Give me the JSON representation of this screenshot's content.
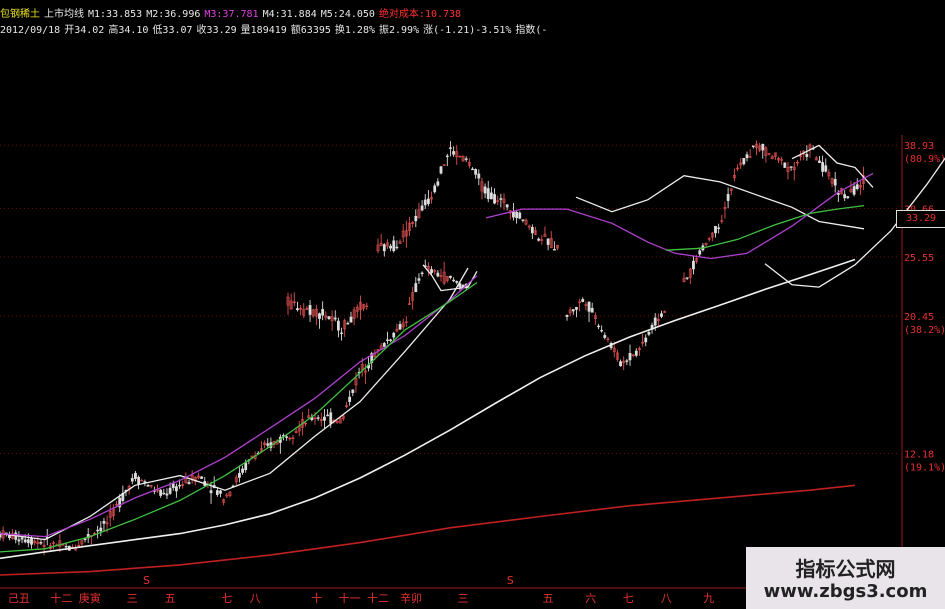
{
  "header": {
    "line1": [
      {
        "text": "包钢稀土",
        "color": "yellow"
      },
      {
        "text": "上市均线",
        "color": "white"
      },
      {
        "text": "M1:33.853",
        "color": "white"
      },
      {
        "text": "M2:36.996",
        "color": "white"
      },
      {
        "text": "M3:37.781",
        "color": "magenta"
      },
      {
        "text": "M4:31.884",
        "color": "white"
      },
      {
        "text": "M5:24.050",
        "color": "white"
      },
      {
        "text": "绝对成本:10.738",
        "color": "red"
      }
    ],
    "line2": [
      {
        "text": "2012/09/18",
        "color": "white"
      },
      {
        "text": "开34.02",
        "color": "white"
      },
      {
        "text": "高34.10",
        "color": "white"
      },
      {
        "text": "低33.07",
        "color": "white"
      },
      {
        "text": "收33.29",
        "color": "white"
      },
      {
        "text": "量189419",
        "color": "white"
      },
      {
        "text": "额63395",
        "color": "white"
      },
      {
        "text": "换1.28%",
        "color": "white"
      },
      {
        "text": "振2.99%",
        "color": "white"
      },
      {
        "text": "涨(-1.21)-3.51%",
        "color": "white"
      },
      {
        "text": "指数(-",
        "color": "white"
      }
    ]
  },
  "current_price_label": "33.29",
  "watermark": {
    "title": "指标公式网",
    "url": "www.zbgs3.com"
  },
  "colors": {
    "background": "#000000",
    "label_red": "#e83030",
    "ma_white": "#eeeeee",
    "ma_magenta": "#b040d0",
    "ma_green": "#40c040",
    "ma_long_white": "#f0f0f0",
    "ma_red": "#c02020",
    "candle_up": "#e05050",
    "candle_down": "#dddddd"
  },
  "chart_data": {
    "type": "line",
    "scale": "log",
    "y_ticks": [
      {
        "value": 38.93,
        "label": "38.93",
        "pct": "(80.9%)"
      },
      {
        "value": 30.66,
        "label": "30.66",
        "pct": "(61.8%)"
      },
      {
        "value": 25.55,
        "label": "25.55",
        "pct": ""
      },
      {
        "value": 20.45,
        "label": "20.45",
        "pct": "(38.2%)"
      },
      {
        "value": 12.18,
        "label": "12.18",
        "pct": "(19.1%)"
      }
    ],
    "ylim": [
      7.5,
      40
    ],
    "x_ticks": [
      "己丑",
      "十二",
      "庚寅",
      "三",
      "五",
      "七",
      "八",
      "十",
      "十一",
      "十二",
      "辛卯",
      "三",
      "五",
      "六",
      "七",
      "八",
      "九",
      "十一",
      "十二",
      "壬辰",
      "三"
    ],
    "x_range": [
      0,
      100
    ],
    "x_tick_positions": [
      4,
      13,
      19,
      28,
      36,
      48,
      54,
      67,
      74,
      80,
      87,
      98,
      116,
      125,
      133,
      141,
      150,
      165,
      172,
      180,
      190
    ],
    "tick_domain": [
      0,
      200
    ],
    "markers": [
      {
        "x": 31,
        "label": "S"
      },
      {
        "x": 108,
        "label": "S"
      }
    ],
    "series": [
      {
        "key": "ma_short",
        "values": [
          [
            0,
            9.0
          ],
          [
            5,
            8.8
          ],
          [
            10,
            9.6
          ],
          [
            15,
            10.8
          ],
          [
            20,
            11.2
          ],
          [
            25,
            10.6
          ],
          [
            30,
            11.3
          ],
          [
            35,
            13.0
          ],
          [
            40,
            14.8
          ],
          [
            45,
            17.9
          ],
          [
            50,
            21.8
          ],
          [
            52,
            24.5
          ]
        ]
      },
      {
        "key": "ma_short_b",
        "values": [
          [
            47,
            24.8
          ],
          [
            48,
            23.8
          ],
          [
            49,
            22.5
          ],
          [
            52,
            22.8
          ],
          [
            53,
            24.2
          ]
        ]
      },
      {
        "key": "ma_short_c",
        "values": [
          [
            64,
            32.0
          ],
          [
            68,
            30.3
          ],
          [
            72,
            31.7
          ],
          [
            76,
            34.7
          ],
          [
            80,
            33.9
          ],
          [
            84,
            32.3
          ],
          [
            88,
            30.8
          ],
          [
            91,
            29.2
          ],
          [
            96,
            28.4
          ]
        ]
      },
      {
        "key": "ma_short_d",
        "values": [
          [
            85,
            24.9
          ],
          [
            88,
            23.0
          ],
          [
            91,
            22.8
          ],
          [
            95,
            24.8
          ],
          [
            99,
            28.2
          ],
          [
            103,
            33.6
          ],
          [
            106,
            38.9
          ]
        ]
      },
      {
        "key": "ma_short_e",
        "values": [
          [
            88,
            37.0
          ],
          [
            91,
            38.9
          ],
          [
            93,
            36.4
          ],
          [
            95,
            35.8
          ],
          [
            97,
            33.2
          ]
        ]
      },
      {
        "key": "ma_mid",
        "values": [
          [
            0,
            9.0
          ],
          [
            5,
            8.9
          ],
          [
            10,
            9.5
          ],
          [
            15,
            10.3
          ],
          [
            20,
            11.0
          ],
          [
            25,
            12.0
          ],
          [
            30,
            13.4
          ],
          [
            35,
            15.0
          ],
          [
            40,
            17.2
          ],
          [
            45,
            19.0
          ],
          [
            50,
            21.7
          ],
          [
            53,
            23.8
          ]
        ]
      },
      {
        "key": "ma_mid_b",
        "values": [
          [
            54,
            29.6
          ],
          [
            58,
            30.6
          ],
          [
            63,
            30.6
          ],
          [
            68,
            29.0
          ],
          [
            72,
            27.0
          ],
          [
            75,
            25.9
          ],
          [
            79,
            25.4
          ],
          [
            83,
            25.9
          ],
          [
            88,
            28.7
          ],
          [
            93,
            32.5
          ],
          [
            97,
            35.0
          ]
        ]
      },
      {
        "key": "ma_green",
        "values": [
          [
            0,
            8.4
          ],
          [
            5,
            8.5
          ],
          [
            10,
            8.9
          ],
          [
            15,
            9.5
          ],
          [
            20,
            10.2
          ],
          [
            25,
            11.2
          ],
          [
            30,
            12.5
          ],
          [
            35,
            14.1
          ],
          [
            40,
            16.5
          ],
          [
            45,
            19.4
          ],
          [
            50,
            21.6
          ],
          [
            53,
            23.2
          ]
        ]
      },
      {
        "key": "ma_green_b",
        "values": [
          [
            74,
            26.2
          ],
          [
            78,
            26.4
          ],
          [
            82,
            27.3
          ],
          [
            86,
            28.8
          ],
          [
            90,
            30.1
          ],
          [
            93,
            30.6
          ],
          [
            96,
            31.0
          ]
        ]
      },
      {
        "key": "ma_long",
        "values": [
          [
            0,
            8.2
          ],
          [
            5,
            8.4
          ],
          [
            10,
            8.6
          ],
          [
            15,
            8.8
          ],
          [
            20,
            9.0
          ],
          [
            25,
            9.3
          ],
          [
            30,
            9.7
          ],
          [
            35,
            10.3
          ],
          [
            40,
            11.1
          ],
          [
            45,
            12.1
          ],
          [
            50,
            13.3
          ],
          [
            55,
            14.7
          ],
          [
            60,
            16.2
          ],
          [
            65,
            17.6
          ],
          [
            70,
            18.9
          ],
          [
            75,
            20.1
          ],
          [
            80,
            21.3
          ],
          [
            85,
            22.6
          ],
          [
            90,
            23.9
          ],
          [
            95,
            25.3
          ]
        ]
      },
      {
        "key": "ma_red",
        "values": [
          [
            0,
            7.7
          ],
          [
            10,
            7.8
          ],
          [
            20,
            8.0
          ],
          [
            30,
            8.3
          ],
          [
            40,
            8.7
          ],
          [
            50,
            9.2
          ],
          [
            60,
            9.6
          ],
          [
            70,
            10.0
          ],
          [
            80,
            10.3
          ],
          [
            90,
            10.6
          ],
          [
            95,
            10.8
          ]
        ]
      }
    ],
    "candle_segments": [
      {
        "x0": 0,
        "x1": 52,
        "start": 9.0,
        "path": [
          [
            0,
            9.0
          ],
          [
            5,
            8.7
          ],
          [
            8,
            8.5
          ],
          [
            12,
            9.4
          ],
          [
            15,
            11.2
          ],
          [
            18,
            10.4
          ],
          [
            22,
            11.2
          ],
          [
            25,
            10.3
          ],
          [
            28,
            12.0
          ],
          [
            32,
            13.1
          ],
          [
            35,
            14.0
          ],
          [
            38,
            13.8
          ],
          [
            40,
            16.6
          ],
          [
            42,
            17.9
          ],
          [
            45,
            20.0
          ],
          [
            47,
            24.5
          ],
          [
            50,
            23.5
          ],
          [
            52,
            22.7
          ]
        ]
      },
      {
        "x0": 32,
        "x1": 41,
        "start": 21.5,
        "path": [
          [
            32,
            21.5
          ],
          [
            34,
            21.0
          ],
          [
            36,
            20.6
          ],
          [
            38,
            19.5
          ],
          [
            40,
            21.0
          ],
          [
            41,
            21.5
          ]
        ]
      },
      {
        "x0": 42,
        "x1": 62,
        "start": 26.3,
        "path": [
          [
            42,
            26.3
          ],
          [
            44,
            26.8
          ],
          [
            46,
            29.3
          ],
          [
            48,
            32.4
          ],
          [
            50,
            38.2
          ],
          [
            52,
            36.6
          ],
          [
            54,
            32.6
          ],
          [
            56,
            31.3
          ],
          [
            58,
            29.6
          ],
          [
            60,
            27.5
          ],
          [
            62,
            26.5
          ]
        ]
      },
      {
        "x0": 63,
        "x1": 74,
        "start": 20.5,
        "path": [
          [
            63,
            20.5
          ],
          [
            65,
            21.8
          ],
          [
            67,
            19.3
          ],
          [
            69,
            17.1
          ],
          [
            71,
            18.0
          ],
          [
            73,
            20.2
          ],
          [
            74,
            21.0
          ]
        ]
      },
      {
        "x0": 76,
        "x1": 96,
        "start": 23.0,
        "path": [
          [
            76,
            23.0
          ],
          [
            78,
            26.3
          ],
          [
            80,
            29.0
          ],
          [
            82,
            35.6
          ],
          [
            84,
            38.9
          ],
          [
            86,
            37.2
          ],
          [
            88,
            35.7
          ],
          [
            90,
            38.5
          ],
          [
            92,
            34.8
          ],
          [
            94,
            31.9
          ],
          [
            96,
            34.0
          ]
        ]
      }
    ]
  }
}
